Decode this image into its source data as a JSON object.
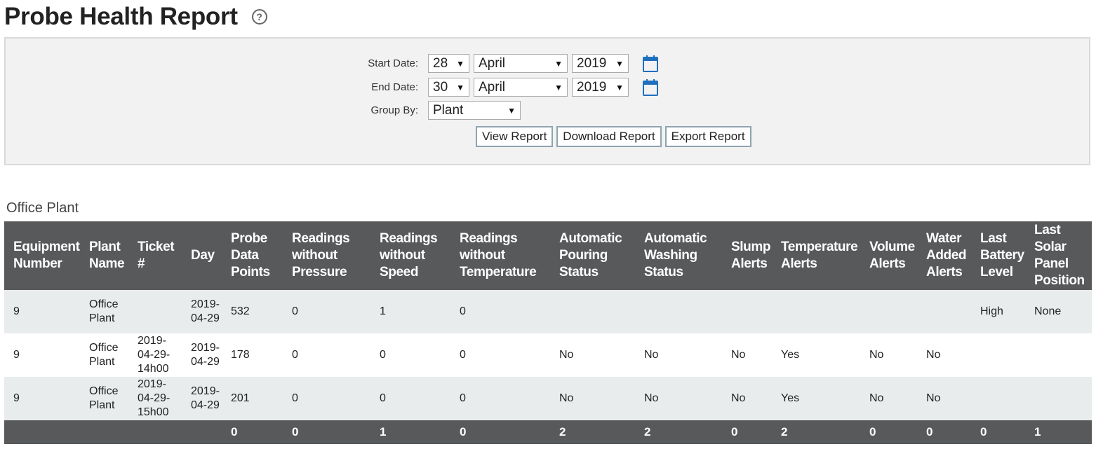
{
  "header": {
    "title": "Probe Health Report",
    "help_icon": "?"
  },
  "filters": {
    "start_label": "Start Date:",
    "start_day": "28",
    "start_month": "April",
    "start_year": "2019",
    "end_label": "End Date:",
    "end_day": "30",
    "end_month": "April",
    "end_year": "2019",
    "group_label": "Group By:",
    "group_value": "Plant",
    "view_button": "View Report",
    "download_button": "Download Report",
    "export_button": "Export Report",
    "calendar_color": "#1f6fbf"
  },
  "group": {
    "title": "Office Plant"
  },
  "table": {
    "columns": [
      "Equipment Number",
      "Plant Name",
      "Ticket #",
      "Day",
      "Probe Data Points",
      "Readings without Pressure",
      "Readings without Speed",
      "Readings without Temperature",
      "Automatic Pouring Status",
      "Automatic Washing Status",
      "Slump Alerts",
      "Temperature Alerts",
      "Volume Alerts",
      "Water Added Alerts",
      "Last Battery Level",
      "Last Solar Panel Position"
    ],
    "rows": [
      [
        "9",
        "Office Plant",
        "",
        "2019-04-29",
        "532",
        "0",
        "1",
        "0",
        "",
        "",
        "",
        "",
        "",
        "",
        "High",
        "None"
      ],
      [
        "9",
        "Office Plant",
        "2019-04-29-14h00",
        "2019-04-29",
        "178",
        "0",
        "0",
        "0",
        "No",
        "No",
        "No",
        "Yes",
        "No",
        "No",
        "",
        ""
      ],
      [
        "9",
        "Office Plant",
        "2019-04-29-15h00",
        "2019-04-29",
        "201",
        "0",
        "0",
        "0",
        "No",
        "No",
        "No",
        "Yes",
        "No",
        "No",
        "",
        ""
      ]
    ],
    "totals": [
      "",
      "",
      "",
      "",
      "0",
      "0",
      "1",
      "0",
      "2",
      "2",
      "0",
      "2",
      "0",
      "0",
      "0",
      "1"
    ]
  },
  "colors": {
    "header_bg": "#58595b",
    "row_alt": "#e8ecec",
    "panel_bg": "#f1f2f1"
  }
}
